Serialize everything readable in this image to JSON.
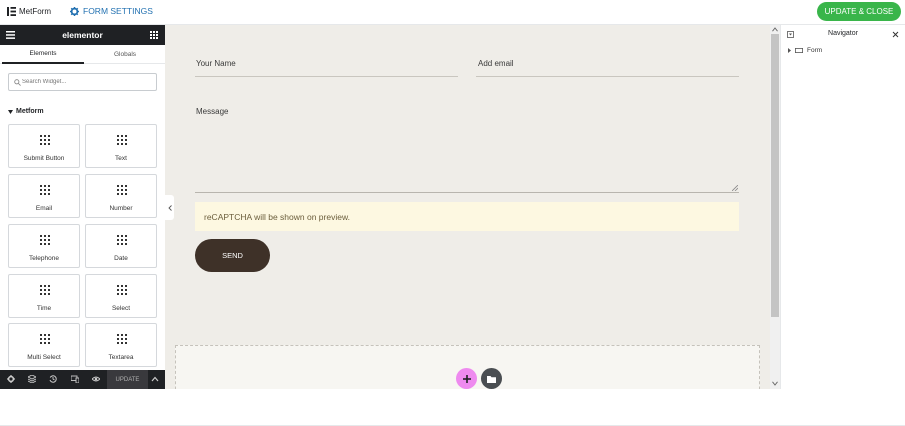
{
  "topbar": {
    "title": "MetForm",
    "settings_label": "FORM SETTINGS",
    "update_label": "UPDATE & CLOSE"
  },
  "panel": {
    "brand": "elementor",
    "tabs": [
      "Elements",
      "Globals"
    ],
    "search_placeholder": "Search Widget...",
    "section_title": "Metform",
    "widgets": [
      "Submit Button",
      "Text",
      "Email",
      "Number",
      "Telephone",
      "Date",
      "Time",
      "Select",
      "Multi Select",
      "Textarea"
    ],
    "bottom_update_label": "UPDATE"
  },
  "form": {
    "name_label": "Your Name",
    "email_label": "Add email",
    "message_label": "Message",
    "recaptcha_text": "reCAPTCHA will be shown on preview.",
    "send_label": "SEND"
  },
  "navigator": {
    "title": "Navigator",
    "items": [
      "Form"
    ]
  },
  "colors": {
    "accent_green": "#39b54a",
    "link_blue": "#2271b1",
    "panel_dark": "#1f2124",
    "canvas_bg": "#efede8",
    "send_button": "#3e3128",
    "add_button": "#ee8aef"
  }
}
